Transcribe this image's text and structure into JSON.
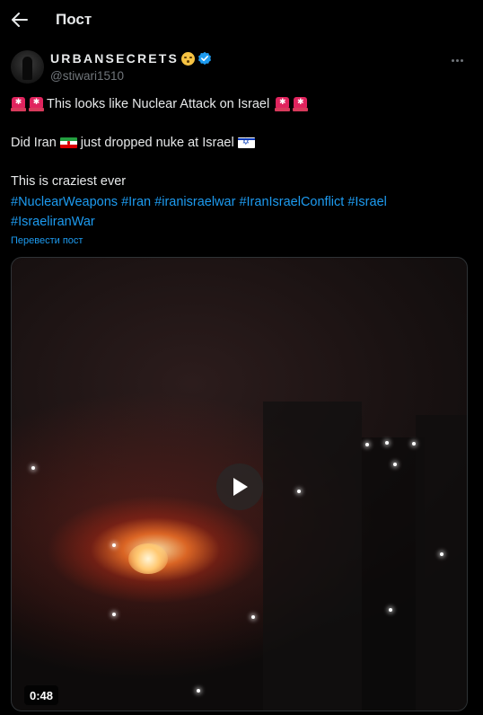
{
  "header": {
    "back_icon": "arrow-left-icon",
    "title": "Пост"
  },
  "author": {
    "display_name": "URBANSECRETS",
    "name_emoji": "hushed-face-emoji",
    "verified_icon": "verified-badge-icon",
    "verified_color": "#1d9bf0",
    "handle": "@stiwari1510",
    "more_icon": "more-horizontal-icon"
  },
  "post": {
    "line1": "This looks like Nuclear Attack on Israel",
    "line1_emoji": "police-car-light-emoji",
    "line2_prefix": "Did Iran",
    "line2_middle": "just dropped nuke at Israel",
    "line2_flags": [
      "iran-flag-emoji",
      "israel-flag-emoji"
    ],
    "line3": "This is craziest ever",
    "hashtags": [
      "#NuclearWeapons",
      "#Iran",
      "#iranisraelwar",
      "#IranIsraelConflict",
      "#Israel",
      "#IsraeliranWar"
    ],
    "translate_link": "Перевести пост"
  },
  "media": {
    "type": "video",
    "play_icon": "play-icon",
    "duration": "0:48"
  },
  "colors": {
    "background": "#000000",
    "text": "#e7e9ea",
    "secondary_text": "#71767b",
    "link": "#1d9bf0"
  }
}
